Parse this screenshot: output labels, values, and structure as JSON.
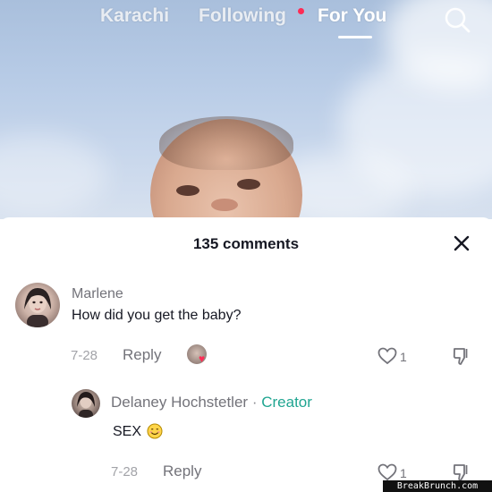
{
  "top_nav": {
    "tabs": [
      {
        "label": "Karachi"
      },
      {
        "label": "Following"
      },
      {
        "label": "For You"
      }
    ],
    "active_tab": "For You",
    "icons": {
      "search": "search-icon"
    },
    "colors": {
      "notification_dot": "#fe2c55",
      "tab_active": "#ffffff"
    }
  },
  "comments_sheet": {
    "title": "135 comments",
    "icons": {
      "close": "close-icon"
    },
    "comments": [
      {
        "username": "Marlene",
        "text": "How did you get the baby?",
        "date": "7-28",
        "reply_label": "Reply",
        "like_count": "1"
      }
    ],
    "replies": [
      {
        "username": "Delaney Hochstetler",
        "separator": "·",
        "badge": "Creator",
        "text": "SEX",
        "date": "7-28",
        "reply_label": "Reply",
        "like_count": "1"
      }
    ],
    "colors": {
      "creator_badge": "#20a591",
      "liked_heart": "#fe2c55",
      "text_primary": "#161823",
      "text_secondary": "#73737a"
    }
  },
  "watermark": {
    "text": "BreakBrunch.com"
  }
}
